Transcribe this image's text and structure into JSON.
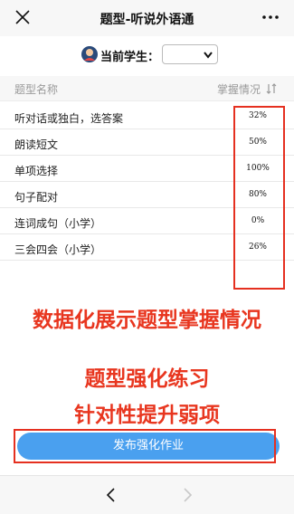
{
  "titlebar": {
    "title": "题型-听说外语通"
  },
  "student": {
    "label": "当前学生：",
    "selected": ""
  },
  "table": {
    "col_name": "题型名称",
    "col_status": "掌握情况",
    "rows": [
      {
        "name": "听对话或独白，选答案",
        "pct": "32%"
      },
      {
        "name": "朗读短文",
        "pct": "50%"
      },
      {
        "name": "单项选择",
        "pct": "100%"
      },
      {
        "name": "句子配对",
        "pct": "80%"
      },
      {
        "name": "连词成句（小学）",
        "pct": "0%"
      },
      {
        "name": "三会四会（小学）",
        "pct": "26%"
      }
    ]
  },
  "promo": {
    "line1": "数据化展示题型掌握情况",
    "line2": "题型强化练习",
    "line3": "针对性提升弱项"
  },
  "publish_button": "发布强化作业",
  "colors": {
    "accent_red": "#e8361f",
    "button_blue": "#4aa0ef"
  },
  "icons": [
    "close-icon",
    "more-icon",
    "avatar-icon",
    "chevron-down-icon",
    "sort-icon",
    "back-icon",
    "forward-icon"
  ]
}
